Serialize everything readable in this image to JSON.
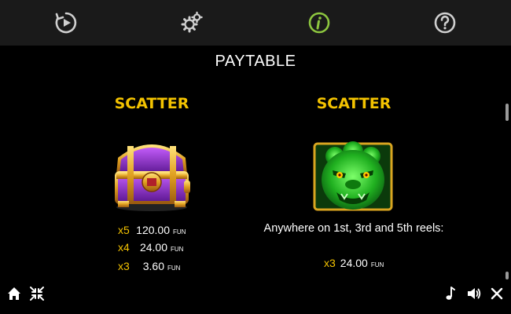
{
  "topbar": {
    "buttons": [
      {
        "icon": "autoplay-icon",
        "color": "#cfcfcf"
      },
      {
        "icon": "settings-icon",
        "color": "#cfcfcf"
      },
      {
        "icon": "info-icon",
        "color": "#8dc63f",
        "active": true
      },
      {
        "icon": "help-icon",
        "color": "#cfcfcf"
      }
    ]
  },
  "page": {
    "title": "PAYTABLE"
  },
  "symbols": [
    {
      "name": "SCATTER",
      "icon": "treasure-chest-icon",
      "pays": [
        {
          "mult": "x5",
          "amount": "120.00",
          "currency": "FUN"
        },
        {
          "mult": "x4",
          "amount": "24.00",
          "currency": "FUN"
        },
        {
          "mult": "x3",
          "amount": "3.60",
          "currency": "FUN"
        }
      ]
    },
    {
      "name": "SCATTER",
      "icon": "jade-lion-icon",
      "note": "Anywhere on 1st, 3rd and 5th reels:",
      "pays": [
        {
          "mult": "x3",
          "amount": "24.00",
          "currency": "FUN"
        }
      ]
    }
  ],
  "bottombar": {
    "left": [
      "home-icon",
      "collapse-icon"
    ],
    "right": [
      "music-icon",
      "sound-icon",
      "close-icon"
    ]
  },
  "colors": {
    "accent": "#f4c300",
    "active_icon": "#8dc63f",
    "topbar_bg": "#1a1a1a"
  }
}
